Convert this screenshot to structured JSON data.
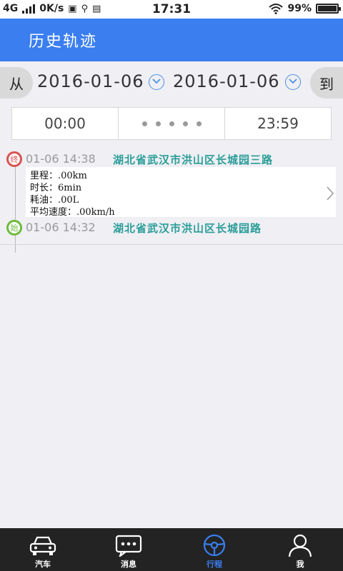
{
  "status_bar": {
    "network": "4G",
    "speed": "0K/s",
    "time": "17:31",
    "battery": "99%"
  },
  "header": {
    "title": "历史轨迹"
  },
  "date_range": {
    "from_label": "从",
    "start_date": "2016-01-06",
    "end_date": "2016-01-06",
    "to_label": "到"
  },
  "time_range": {
    "start_time": "00:00",
    "end_time": "23:59"
  },
  "trip": {
    "end": {
      "badge": "终",
      "timestamp": "01-06 14:38",
      "address": "湖北省武汉市洪山区长城园三路"
    },
    "details": {
      "mileage": "里程：.00km",
      "duration": "时长：6min",
      "fuel": "耗油：.00L",
      "avg_speed": "平均速度：.00km/h"
    },
    "start": {
      "badge": "始",
      "timestamp": "01-06 14:32",
      "address": "湖北省武汉市洪山区长城园路"
    }
  },
  "nav": {
    "items": [
      {
        "label": "汽车",
        "icon": "car-icon"
      },
      {
        "label": "消息",
        "icon": "message-icon"
      },
      {
        "label": "行程",
        "icon": "steering-wheel-icon",
        "active": true
      },
      {
        "label": "我",
        "icon": "person-icon"
      }
    ]
  },
  "colors": {
    "accent": "#3a7ef0",
    "end_badge": "#d9534f",
    "start_badge": "#6dbb3a",
    "address": "#2a9d98"
  }
}
